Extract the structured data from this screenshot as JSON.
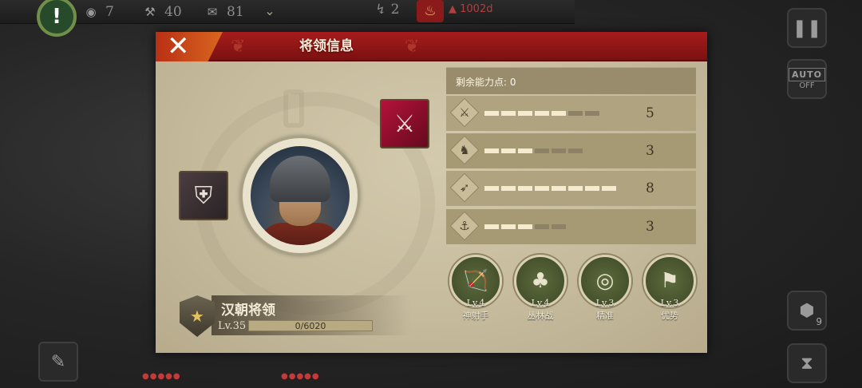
{
  "hud": {
    "stat_1": "7",
    "stat_2": "40",
    "stat_3": "81",
    "mid_stat": "2",
    "score": "1002d",
    "auto_label": "AUTO",
    "auto_state": "OFF",
    "hex_count": "9",
    "alert_symbol": "!"
  },
  "modal": {
    "title": "将领信息",
    "ability_points_label": "剩余能力点:",
    "ability_points_value": "0",
    "general_name": "汉朝将领",
    "level": "Lv.35",
    "xp_text": "0/6020",
    "xp_fraction": 0,
    "stats": [
      {
        "icon": "sword-icon",
        "value": "5",
        "segments_on": 5,
        "segments_total": 7
      },
      {
        "icon": "horse-icon",
        "value": "3",
        "segments_on": 3,
        "segments_total": 6
      },
      {
        "icon": "bow-icon",
        "value": "8",
        "segments_on": 8,
        "segments_total": 8
      },
      {
        "icon": "anchor-icon",
        "value": "3",
        "segments_on": 3,
        "segments_total": 5
      }
    ],
    "skills": [
      {
        "icon": "archer-icon",
        "level": "Lv.4",
        "name": "神射手"
      },
      {
        "icon": "forest-icon",
        "level": "Lv.4",
        "name": "丛林战"
      },
      {
        "icon": "target-icon",
        "level": "Lv.3",
        "name": "精准"
      },
      {
        "icon": "soldiers-icon",
        "level": "Lv.3",
        "name": "优势"
      }
    ]
  },
  "colors": {
    "header_red": "#8b1414",
    "close_orange": "#d9661e",
    "panel_beige": "#c9bea0"
  }
}
